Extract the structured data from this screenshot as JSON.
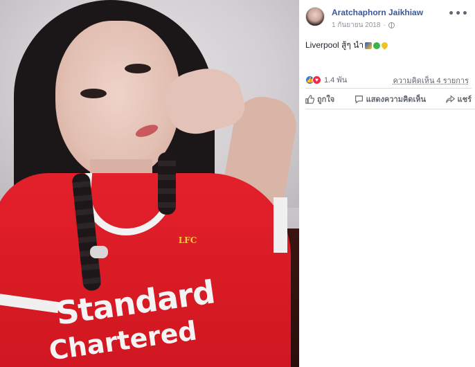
{
  "post": {
    "author": "Aratchaphorn Jaikhiaw",
    "date": "1 กันยายน 2018",
    "separator": "·",
    "more_label": "•••",
    "text": "Liverpool สู้ๆ นำ",
    "emojis": [
      "flag",
      "recycle",
      "yellow-heart"
    ]
  },
  "photo": {
    "crest_text": "LFC",
    "sponsor_line1": "Standard",
    "sponsor_line2": "Chartered"
  },
  "stats": {
    "reaction_count": "1.4 พัน",
    "reaction_types": [
      "like",
      "love"
    ],
    "comments": "ความคิดเห็น 4 รายการ"
  },
  "actions": {
    "like": "ถูกใจ",
    "comment": "แสดงความคิดเห็น",
    "share": "แชร์"
  },
  "colors": {
    "author": "#385898",
    "like": "#3578e5",
    "love": "#f0284a",
    "jersey": "#e3202b"
  }
}
